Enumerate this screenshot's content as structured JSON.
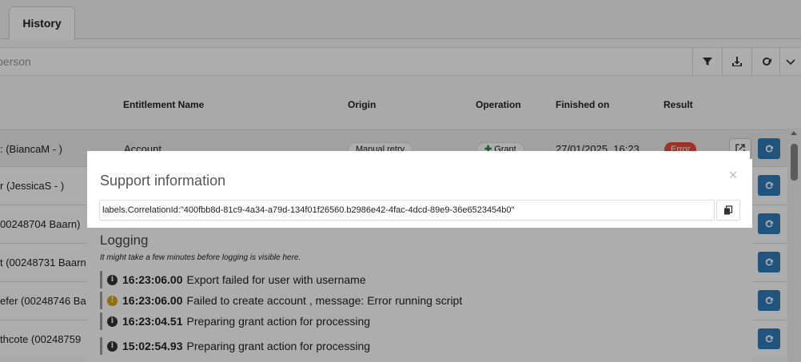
{
  "tabs": [
    {
      "label": "History"
    }
  ],
  "search": {
    "placeholder": "person"
  },
  "table": {
    "headers": {
      "entitlement": "Entitlement Name",
      "origin": "Origin",
      "operation": "Operation",
      "finished": "Finished on",
      "result": "Result"
    },
    "rows": [
      {
        "person": ": (BiancaM - )",
        "entitlement": "Account",
        "origin": "Manual retry",
        "operation": "Grant",
        "finished": "27/01/2025, 16:23",
        "result": "Error"
      },
      {
        "person": "r (JessicaS - )"
      },
      {
        "person": "00248704 Baarn)"
      },
      {
        "person": "t (00248731 Baarn"
      },
      {
        "person": "efer (00248746 Ba"
      },
      {
        "person": "thcote (00248759"
      }
    ]
  },
  "modal": {
    "title": "Support information",
    "close_glyph": "×",
    "correlation_id": "labels.CorrelationId:\"400fbb8d-81c9-4a34-a79d-134f01f26560.b2986e42-4fac-4dcd-89e9-36e6523454b0\""
  },
  "logging": {
    "title": "Logging",
    "note": "It might take a few minutes before logging is visible here.",
    "entries": [
      {
        "level": "info",
        "time": "16:23:06.00",
        "message": "Export failed for user with username"
      },
      {
        "level": "warning",
        "time": "16:23:06.00",
        "message": "Failed to create account , message: Error running script"
      },
      {
        "level": "info",
        "time": "16:23:04.51",
        "message": "Preparing grant action for processing"
      },
      {
        "level": "info",
        "time": "15:02:54.93",
        "message": "Preparing grant action for processing"
      }
    ]
  },
  "icons": {
    "filter": "filter-icon",
    "download": "download-icon",
    "refresh": "refresh-icon",
    "chevron": "chevron-down-icon",
    "external": "external-link-icon",
    "retry": "retry-icon",
    "copy": "copy-icon",
    "info": "info-icon",
    "warning": "warning-icon"
  },
  "colors": {
    "primary_button": "#2d7cb8",
    "error_badge": "#e74c3c",
    "grant_icon": "#1a8f3c",
    "warning_icon": "#d9a316"
  }
}
